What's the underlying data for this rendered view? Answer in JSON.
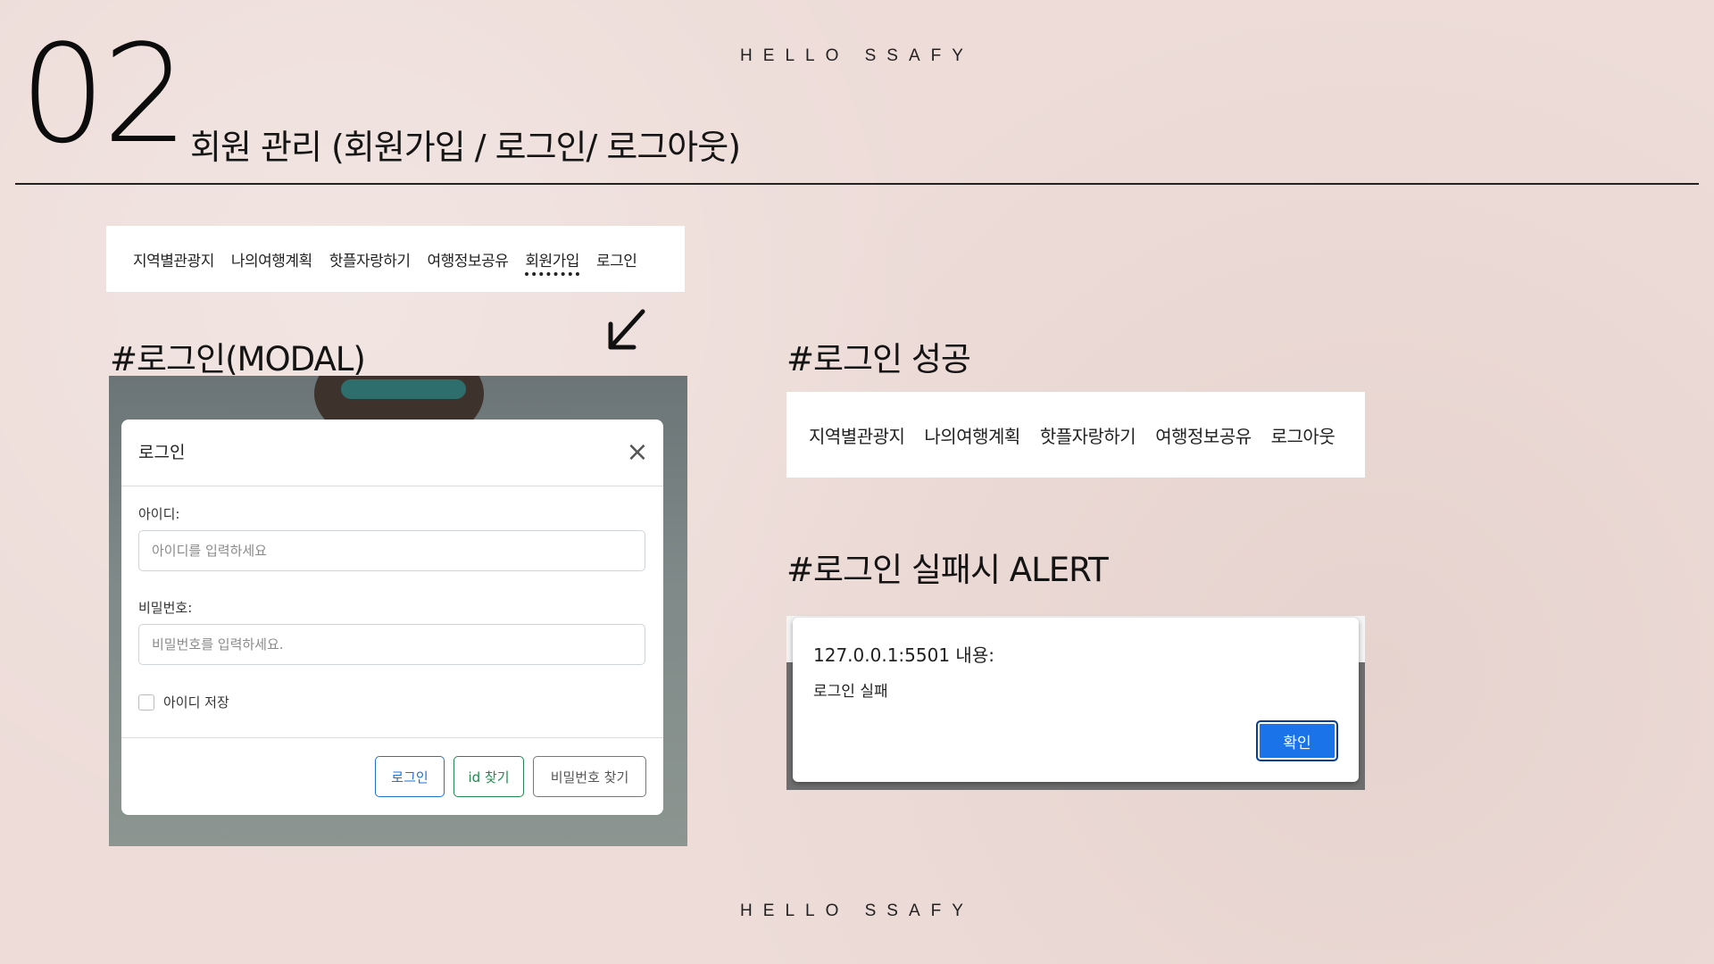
{
  "header": {
    "top_text": "HELLO SSAFY",
    "bottom_text": "HELLO SSAFY"
  },
  "slide": {
    "number": "02",
    "title": "회원 관리 (회원가입 / 로그인/ 로그아웃)"
  },
  "nav_before_login": {
    "items": [
      "지역별관광지",
      "나의여행계획",
      "핫플자랑하기",
      "여행정보공유",
      "회원가입",
      "로그인"
    ],
    "highlighted": "회원가입"
  },
  "nav_after_login": {
    "items": [
      "지역별관광지",
      "나의여행계획",
      "핫플자랑하기",
      "여행정보공유",
      "로그아웃"
    ]
  },
  "sections": {
    "modal_label": "#로그인(MODAL)",
    "success_label": "#로그인 성공",
    "fail_label": "#로그인 실패시 ALERT"
  },
  "login_modal": {
    "title": "로그인",
    "close_icon": "close-icon",
    "id_label": "아이디:",
    "id_placeholder": "아이디를 입력하세요",
    "pw_label": "비밀번호:",
    "pw_placeholder": "비밀번호를 입력하세요.",
    "remember_label": "아이디 저장",
    "buttons": {
      "login": "로그인",
      "find_id": "id 찾기",
      "find_pw": "비밀번호 찾기"
    },
    "colors": {
      "login": "#1e73d8",
      "find_id": "#1f8a4e",
      "find_pw": "#777777"
    }
  },
  "alert": {
    "origin": "127.0.0.1:5501 내용:",
    "message": "로그인 실패",
    "ok_label": "확인",
    "ok_color": "#1a73e8"
  }
}
